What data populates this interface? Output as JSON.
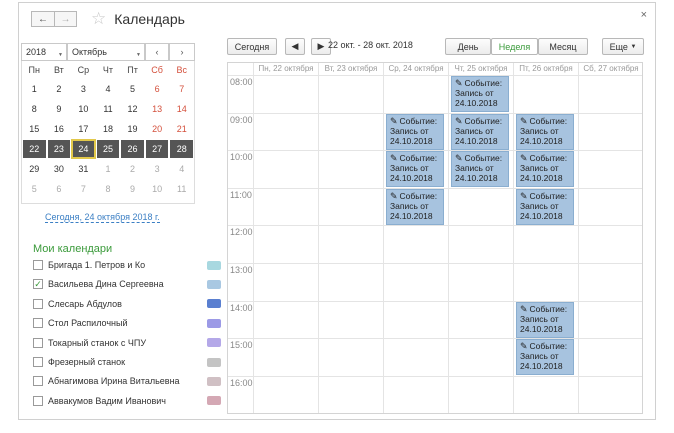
{
  "window": {
    "title": "Календарь",
    "close": "×"
  },
  "nav": {
    "back": "←",
    "forward": "→"
  },
  "toolbar": {
    "today": "Сегодня",
    "prev": "◀",
    "next": "▶",
    "range": "22 окт. - 28 окт. 2018",
    "views": [
      "День",
      "Неделя",
      "Месяц"
    ],
    "active_view": "Неделя",
    "more": "Еще"
  },
  "mini": {
    "year": "2018",
    "month": "Октябрь",
    "prev": "‹",
    "next": "›",
    "dows": [
      "Пн",
      "Вт",
      "Ср",
      "Чт",
      "Пт",
      "Сб",
      "Вс"
    ],
    "weeks": [
      [
        "1",
        "2",
        "3",
        "4",
        "5",
        "6",
        "7"
      ],
      [
        "8",
        "9",
        "10",
        "11",
        "12",
        "13",
        "14"
      ],
      [
        "15",
        "16",
        "17",
        "18",
        "19",
        "20",
        "21"
      ],
      [
        "22",
        "23",
        "24",
        "25",
        "26",
        "27",
        "28"
      ],
      [
        "29",
        "30",
        "31",
        "1",
        "2",
        "3",
        "4"
      ],
      [
        "5",
        "6",
        "7",
        "8",
        "9",
        "10",
        "11"
      ]
    ],
    "selected_week_index": 3,
    "today_day": "24",
    "today_link": "Сегодня, 24 октября 2018 г."
  },
  "calendars": {
    "title": "Мои календари",
    "items": [
      {
        "label": "Бригада 1. Петров и Ко",
        "checked": false,
        "color": "#a8d8e0"
      },
      {
        "label": "Васильева  Дина Сергеевна",
        "checked": true,
        "color": "#a9c8e2"
      },
      {
        "label": "Слесарь Абдулов",
        "checked": false,
        "color": "#5a7fd0"
      },
      {
        "label": "Стол Распилочный",
        "checked": false,
        "color": "#9c9ae6"
      },
      {
        "label": "Токарный станок с ЧПУ",
        "checked": false,
        "color": "#b4a8e8"
      },
      {
        "label": "Фрезерный станок",
        "checked": false,
        "color": "#c4c4c4"
      },
      {
        "label": "Абнагимова Ирина Витальевна",
        "checked": false,
        "color": "#d0c0c4"
      },
      {
        "label": "Аввакумов Вадим Иванович",
        "checked": false,
        "color": "#d4a8b4"
      }
    ]
  },
  "week": {
    "columns": [
      "Пн, 22 октября",
      "Вт, 23 октября",
      "Ср, 24 октября",
      "Чт, 25 октября",
      "Пт, 26 октября",
      "Сб, 27 октября"
    ],
    "hours": [
      "08:00",
      "09:00",
      "10:00",
      "11:00",
      "12:00",
      "13:00",
      "14:00",
      "15:00",
      "16:00"
    ],
    "events": [
      {
        "day": 3,
        "start": "08:00",
        "text": "Событие: Запись от 24.10.2018"
      },
      {
        "day": 2,
        "start": "09:00",
        "text": "Событие: Запись от 24.10.2018"
      },
      {
        "day": 3,
        "start": "09:00",
        "text": "Событие: Запись от 24.10.2018"
      },
      {
        "day": 4,
        "start": "09:00",
        "text": "Событие: Запись от 24.10.2018"
      },
      {
        "day": 2,
        "start": "10:00",
        "text": "Событие: Запись от 24.10.2018"
      },
      {
        "day": 3,
        "start": "10:00",
        "text": "Событие: Запись от 24.10.2018"
      },
      {
        "day": 4,
        "start": "10:00",
        "text": "Событие: Запись от 24.10.2018"
      },
      {
        "day": 2,
        "start": "11:00",
        "text": "Событие: Запись от 24.10.2018"
      },
      {
        "day": 4,
        "start": "11:00",
        "text": "Событие: Запись от 24.10.2018"
      },
      {
        "day": 4,
        "start": "14:00",
        "text": "Событие: Запись от 24.10.2018"
      },
      {
        "day": 4,
        "start": "15:00",
        "text": "Событие: Запись от 24.10.2018"
      }
    ]
  }
}
